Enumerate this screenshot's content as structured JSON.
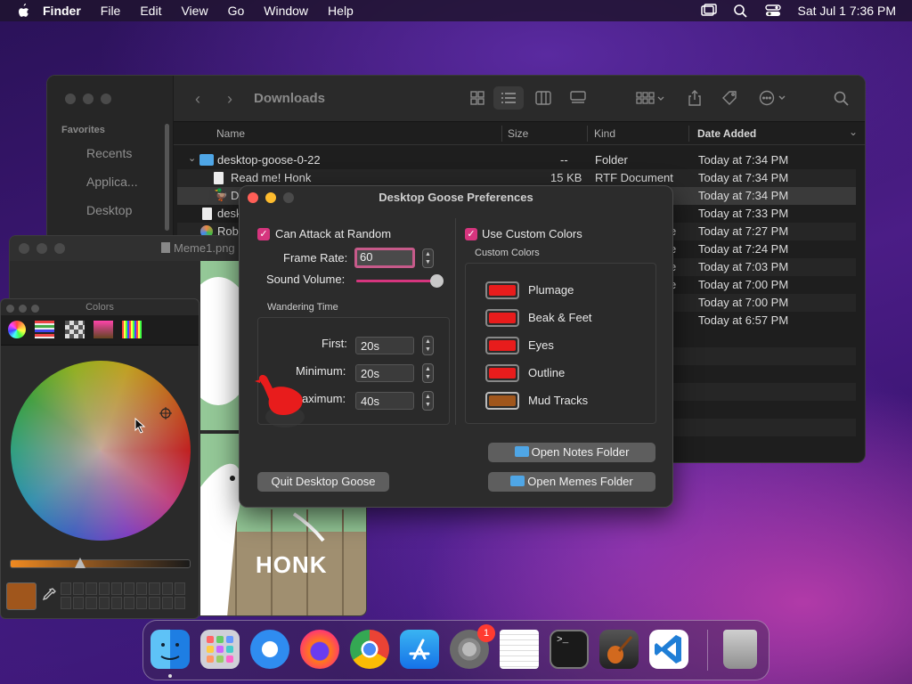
{
  "menubar": {
    "app": "Finder",
    "items": [
      "File",
      "Edit",
      "View",
      "Go",
      "Window",
      "Help"
    ],
    "datetime": "Sat Jul 1  7:36 PM"
  },
  "finder": {
    "title": "Downloads",
    "sidebar": {
      "section": "Favorites",
      "items": [
        "Recents",
        "Applica...",
        "Desktop"
      ]
    },
    "columns": {
      "name": "Name",
      "size": "Size",
      "kind": "Kind",
      "date": "Date Added"
    },
    "rows": [
      {
        "name": "desktop-goose-0-22",
        "size": "--",
        "kind": "Folder",
        "date": "Today at 7:34 PM"
      },
      {
        "name": "Read me! Honk",
        "size": "15 KB",
        "kind": "RTF Document",
        "date": "Today at 7:34 PM"
      },
      {
        "name": "D",
        "size": "",
        "kind": "",
        "date": "Today at 7:34 PM"
      },
      {
        "name": "desk",
        "size": "",
        "kind": "",
        "date": "Today at 7:33 PM"
      },
      {
        "name": "Rob",
        "size": "",
        "kind": "e",
        "date": "Today at 7:27 PM"
      },
      {
        "name": "",
        "size": "",
        "kind": "e",
        "date": "Today at 7:24 PM"
      },
      {
        "name": "",
        "size": "",
        "kind": "e",
        "date": "Today at 7:03 PM"
      },
      {
        "name": "",
        "size": "",
        "kind": "e",
        "date": "Today at 7:00 PM"
      },
      {
        "name": "",
        "size": "",
        "kind": "",
        "date": "Today at 7:00 PM"
      },
      {
        "name": "",
        "size": "",
        "kind": "",
        "date": "Today at 6:57 PM"
      }
    ]
  },
  "meme": {
    "title": "Meme1.png",
    "caption": "HONK"
  },
  "colors_panel": {
    "title": "Colors",
    "selected_color": "#a0561c"
  },
  "prefs": {
    "title": "Desktop Goose Preferences",
    "attack_label": "Can Attack at Random",
    "frame_rate_label": "Frame Rate:",
    "frame_rate_value": "60",
    "sound_volume_label": "Sound Volume:",
    "sound_volume_fraction": 0.94,
    "wandering_title": "Wandering Time",
    "first_label": "First:",
    "first_value": "20s",
    "minimum_label": "Minimum:",
    "minimum_value": "20s",
    "maximum_label": "aximum:",
    "maximum_value": "40s",
    "use_custom_label": "Use Custom Colors",
    "custom_colors_title": "Custom Colors",
    "colors": [
      {
        "label": "Plumage",
        "hex": "#e81c1c"
      },
      {
        "label": "Beak & Feet",
        "hex": "#e81c1c"
      },
      {
        "label": "Eyes",
        "hex": "#e81c1c"
      },
      {
        "label": "Outline",
        "hex": "#e81c1c"
      },
      {
        "label": "Mud Tracks",
        "hex": "#a0561c"
      }
    ],
    "open_notes": "Open Notes Folder",
    "open_memes": "Open Memes Folder",
    "quit": "Quit Desktop Goose"
  },
  "dock": {
    "apps": [
      "finder-icon",
      "launchpad-icon",
      "safari-icon",
      "firefox-icon",
      "chrome-icon",
      "app-store-icon",
      "system-preferences-icon",
      "textedit-icon",
      "terminal-icon",
      "garageband-icon",
      "vscode-icon",
      "trash-icon"
    ],
    "badge": "1"
  }
}
